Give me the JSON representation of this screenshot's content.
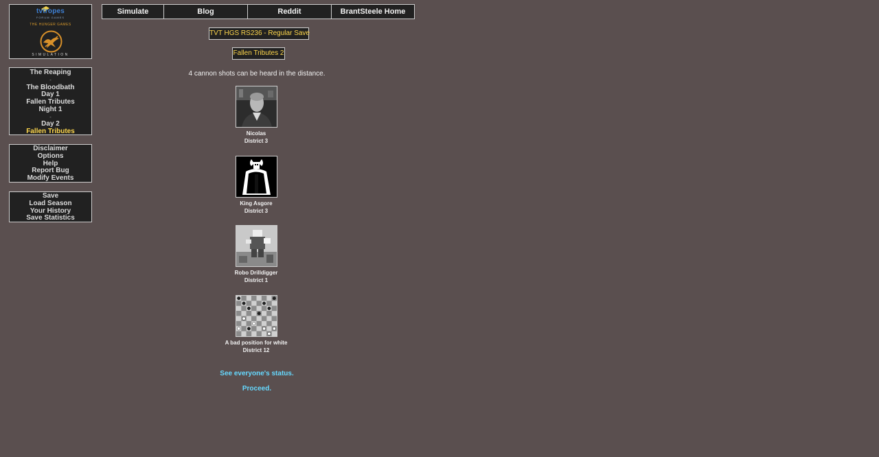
{
  "logo": {
    "brand": "tvtropes",
    "brand_sub": "FORUM GAMES",
    "hunger_games": "THE HUNGER GAMES",
    "simulation": "SIMULATION"
  },
  "sidebar": {
    "nav": [
      {
        "label": "The Reaping",
        "type": "item"
      },
      {
        "label": "-",
        "type": "sep"
      },
      {
        "label": "The Bloodbath",
        "type": "item"
      },
      {
        "label": "Day 1",
        "type": "item"
      },
      {
        "label": "Fallen Tributes",
        "type": "item"
      },
      {
        "label": "Night 1",
        "type": "item"
      },
      {
        "label": "-",
        "type": "sep"
      },
      {
        "label": "Day 2",
        "type": "item"
      },
      {
        "label": "Fallen Tributes",
        "type": "current"
      }
    ],
    "info": [
      "Disclaimer",
      "Options",
      "Help",
      "Report Bug",
      "Modify Events"
    ],
    "save": [
      "Save",
      "Load Season",
      "Your History",
      "Save Statistics"
    ]
  },
  "topnav": [
    {
      "label": "Simulate"
    },
    {
      "label": "Blog"
    },
    {
      "label": "Reddit"
    },
    {
      "label": "BrantSteele Home"
    }
  ],
  "main": {
    "save_title": "TVT HGS RS236 - Regular Save",
    "phase_title": "Fallen Tributes 2",
    "cannon_text": "4 cannon shots can be heard in the distance.",
    "tributes": [
      {
        "name": "Nicolas",
        "district": "District 3",
        "image": "person-photo"
      },
      {
        "name": "King Asgore",
        "district": "District 3",
        "image": "asgore-sprite"
      },
      {
        "name": "Robo Drilldigger",
        "district": "District 1",
        "image": "robot-photo"
      },
      {
        "name": "A bad position for white",
        "district": "District 12",
        "image": "chessboard"
      }
    ],
    "status_link": "See everyone's status.",
    "proceed_link": "Proceed."
  },
  "colors": {
    "background": "#5a4f4f",
    "panel": "#212121",
    "highlight": "#ffd84d",
    "link": "#66d9ff"
  }
}
